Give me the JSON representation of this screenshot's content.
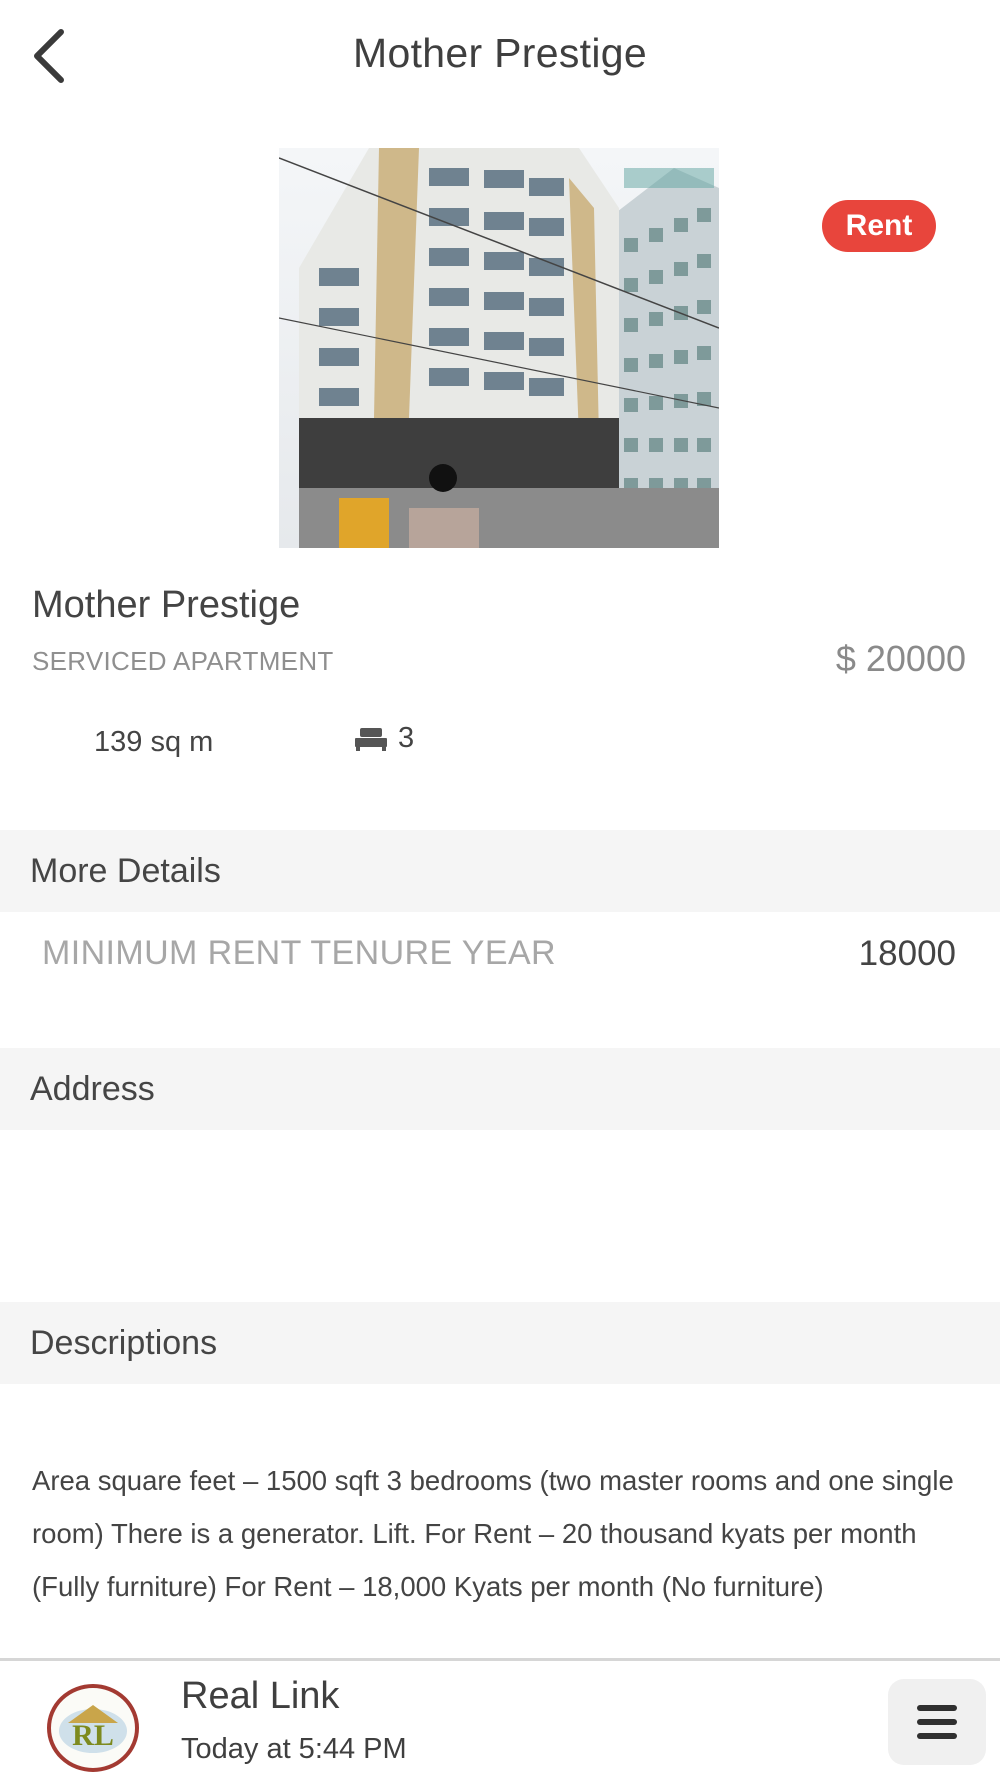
{
  "header": {
    "title": "Mother Prestige",
    "back_icon": "chevron-left-icon"
  },
  "listing": {
    "badge": "Rent",
    "badge_color": "#e8453c",
    "name": "Mother Prestige",
    "type": "SERVICED APARTMENT",
    "price": "$ 20000",
    "area": "139 sq m",
    "bed_icon": "bed-icon",
    "bedrooms": "3"
  },
  "more_details": {
    "heading": "More Details",
    "rows": [
      {
        "label": "MINIMUM RENT TENURE YEAR",
        "value": "18000"
      }
    ]
  },
  "address": {
    "heading": "Address",
    "text": ""
  },
  "descriptions": {
    "heading": "Descriptions",
    "text": "Area square feet – 1500 sqft 3 bedrooms (two master rooms and one single room) There is a generator. Lift. For Rent – 20 thousand kyats per month (Fully furniture) For Rent – 18,000 Kyats per month (No furniture)"
  },
  "footer": {
    "logo_text": "RL",
    "name": "Real Link",
    "time": "Today at 5:44 PM",
    "menu_icon": "hamburger-menu-icon"
  }
}
